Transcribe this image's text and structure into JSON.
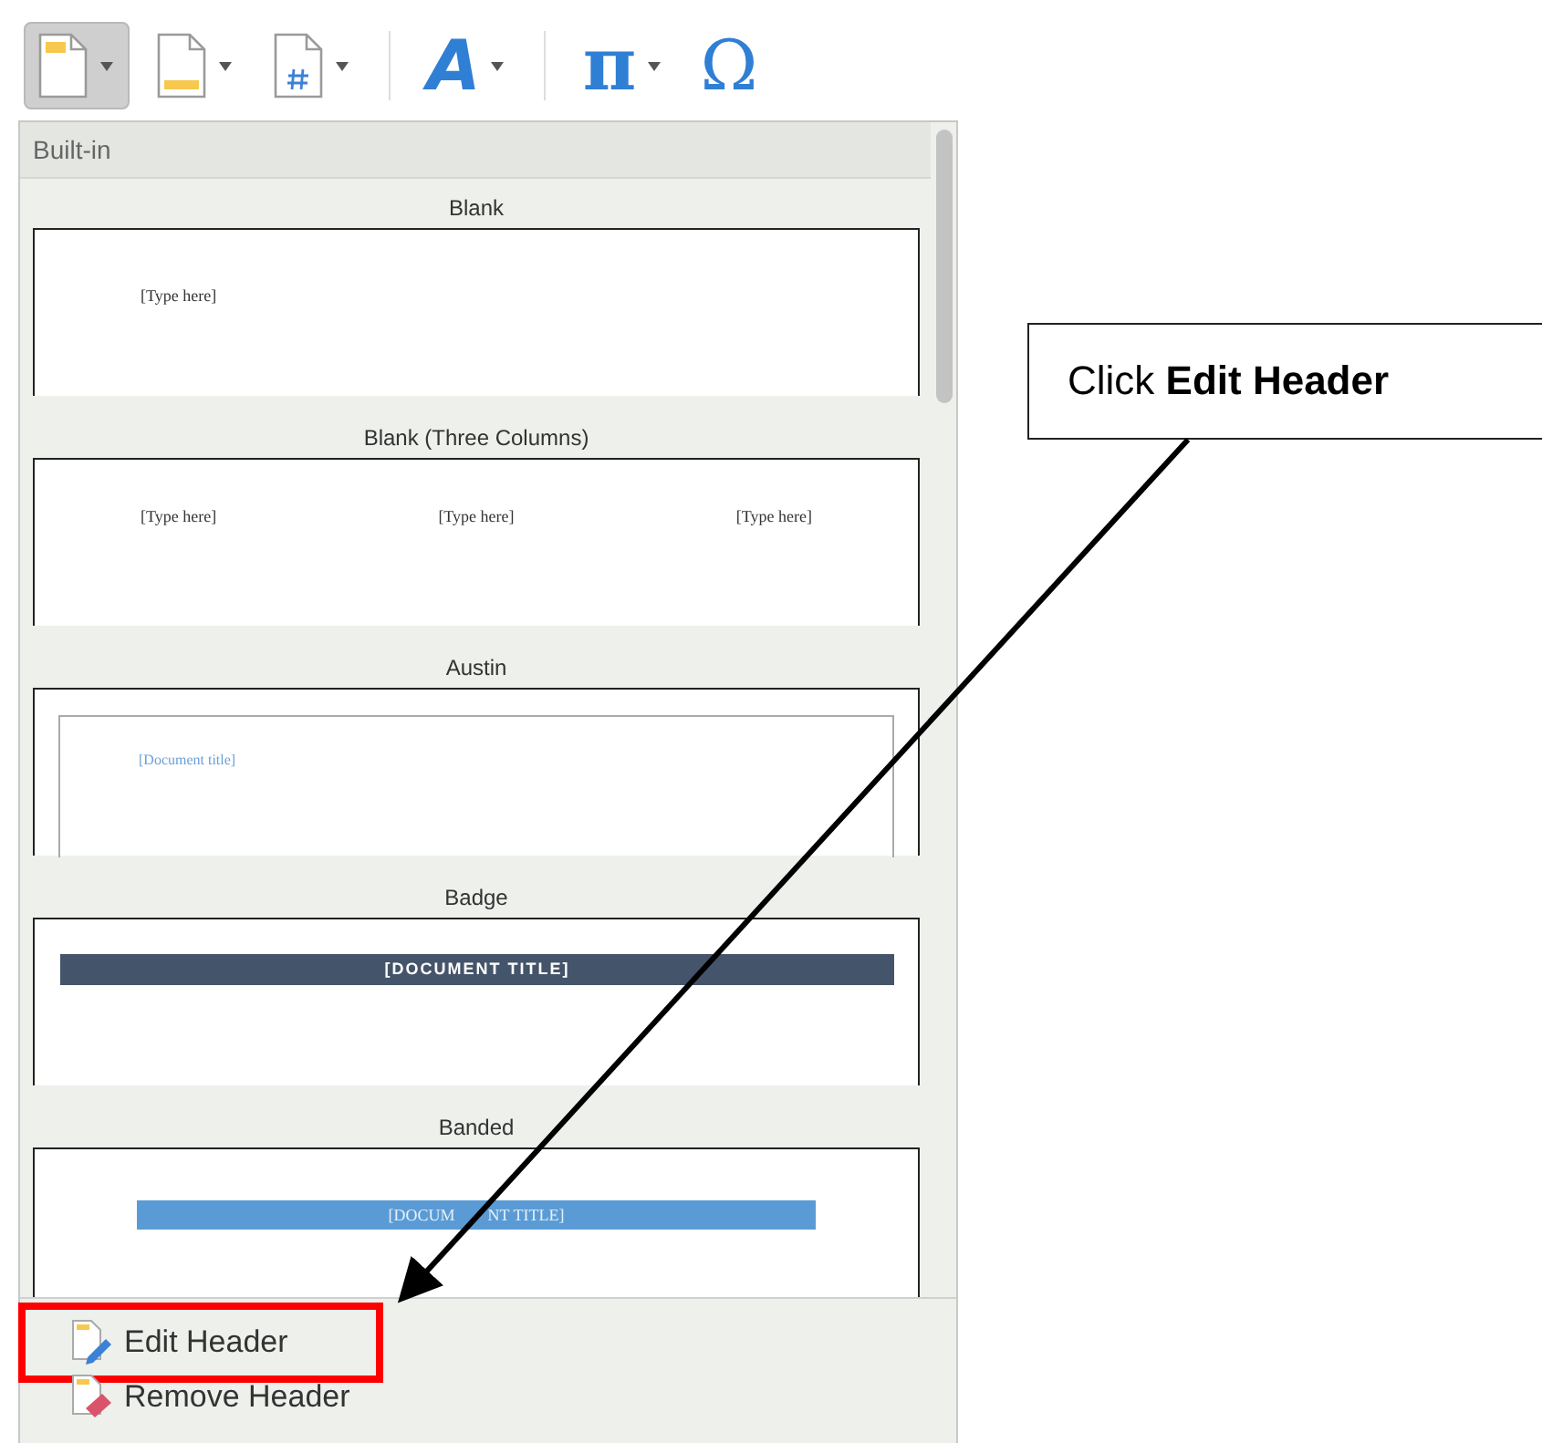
{
  "toolbar": {
    "buttons": [
      {
        "kind": "header",
        "dropdown": true,
        "selected": true
      },
      {
        "kind": "footer",
        "dropdown": true,
        "selected": false
      },
      {
        "kind": "page-number",
        "dropdown": true,
        "selected": false
      },
      {
        "kind": "separator"
      },
      {
        "kind": "glyph",
        "glyph": "A",
        "dropdown": true,
        "selected": false
      },
      {
        "kind": "separator"
      },
      {
        "kind": "glyph",
        "glyph": "π",
        "dropdown": true,
        "selected": false
      },
      {
        "kind": "glyph",
        "glyph": "Ω",
        "selected": false
      }
    ]
  },
  "gallery": {
    "section": "Built-in",
    "items": [
      {
        "name": "Blank",
        "kind": "blank",
        "texts": [
          "[Type here]"
        ]
      },
      {
        "name": "Blank (Three Columns)",
        "kind": "three-columns",
        "texts": [
          "[Type here]",
          "[Type here]",
          "[Type here]"
        ]
      },
      {
        "name": "Austin",
        "kind": "austin",
        "texts": [
          "[Document title]"
        ]
      },
      {
        "name": "Badge",
        "kind": "badge",
        "texts": [
          "[DOCUMENT TITLE]"
        ]
      },
      {
        "name": "Banded",
        "kind": "banded",
        "texts": [
          "[DOCUM",
          "NT TITLE]"
        ]
      }
    ]
  },
  "menu": [
    {
      "label": "Edit Header",
      "kind": "edit",
      "highlighted": true
    },
    {
      "label": "Remove Header",
      "kind": "remove",
      "highlighted": false
    }
  ],
  "callout": {
    "text": "Click **Edit Header**"
  }
}
